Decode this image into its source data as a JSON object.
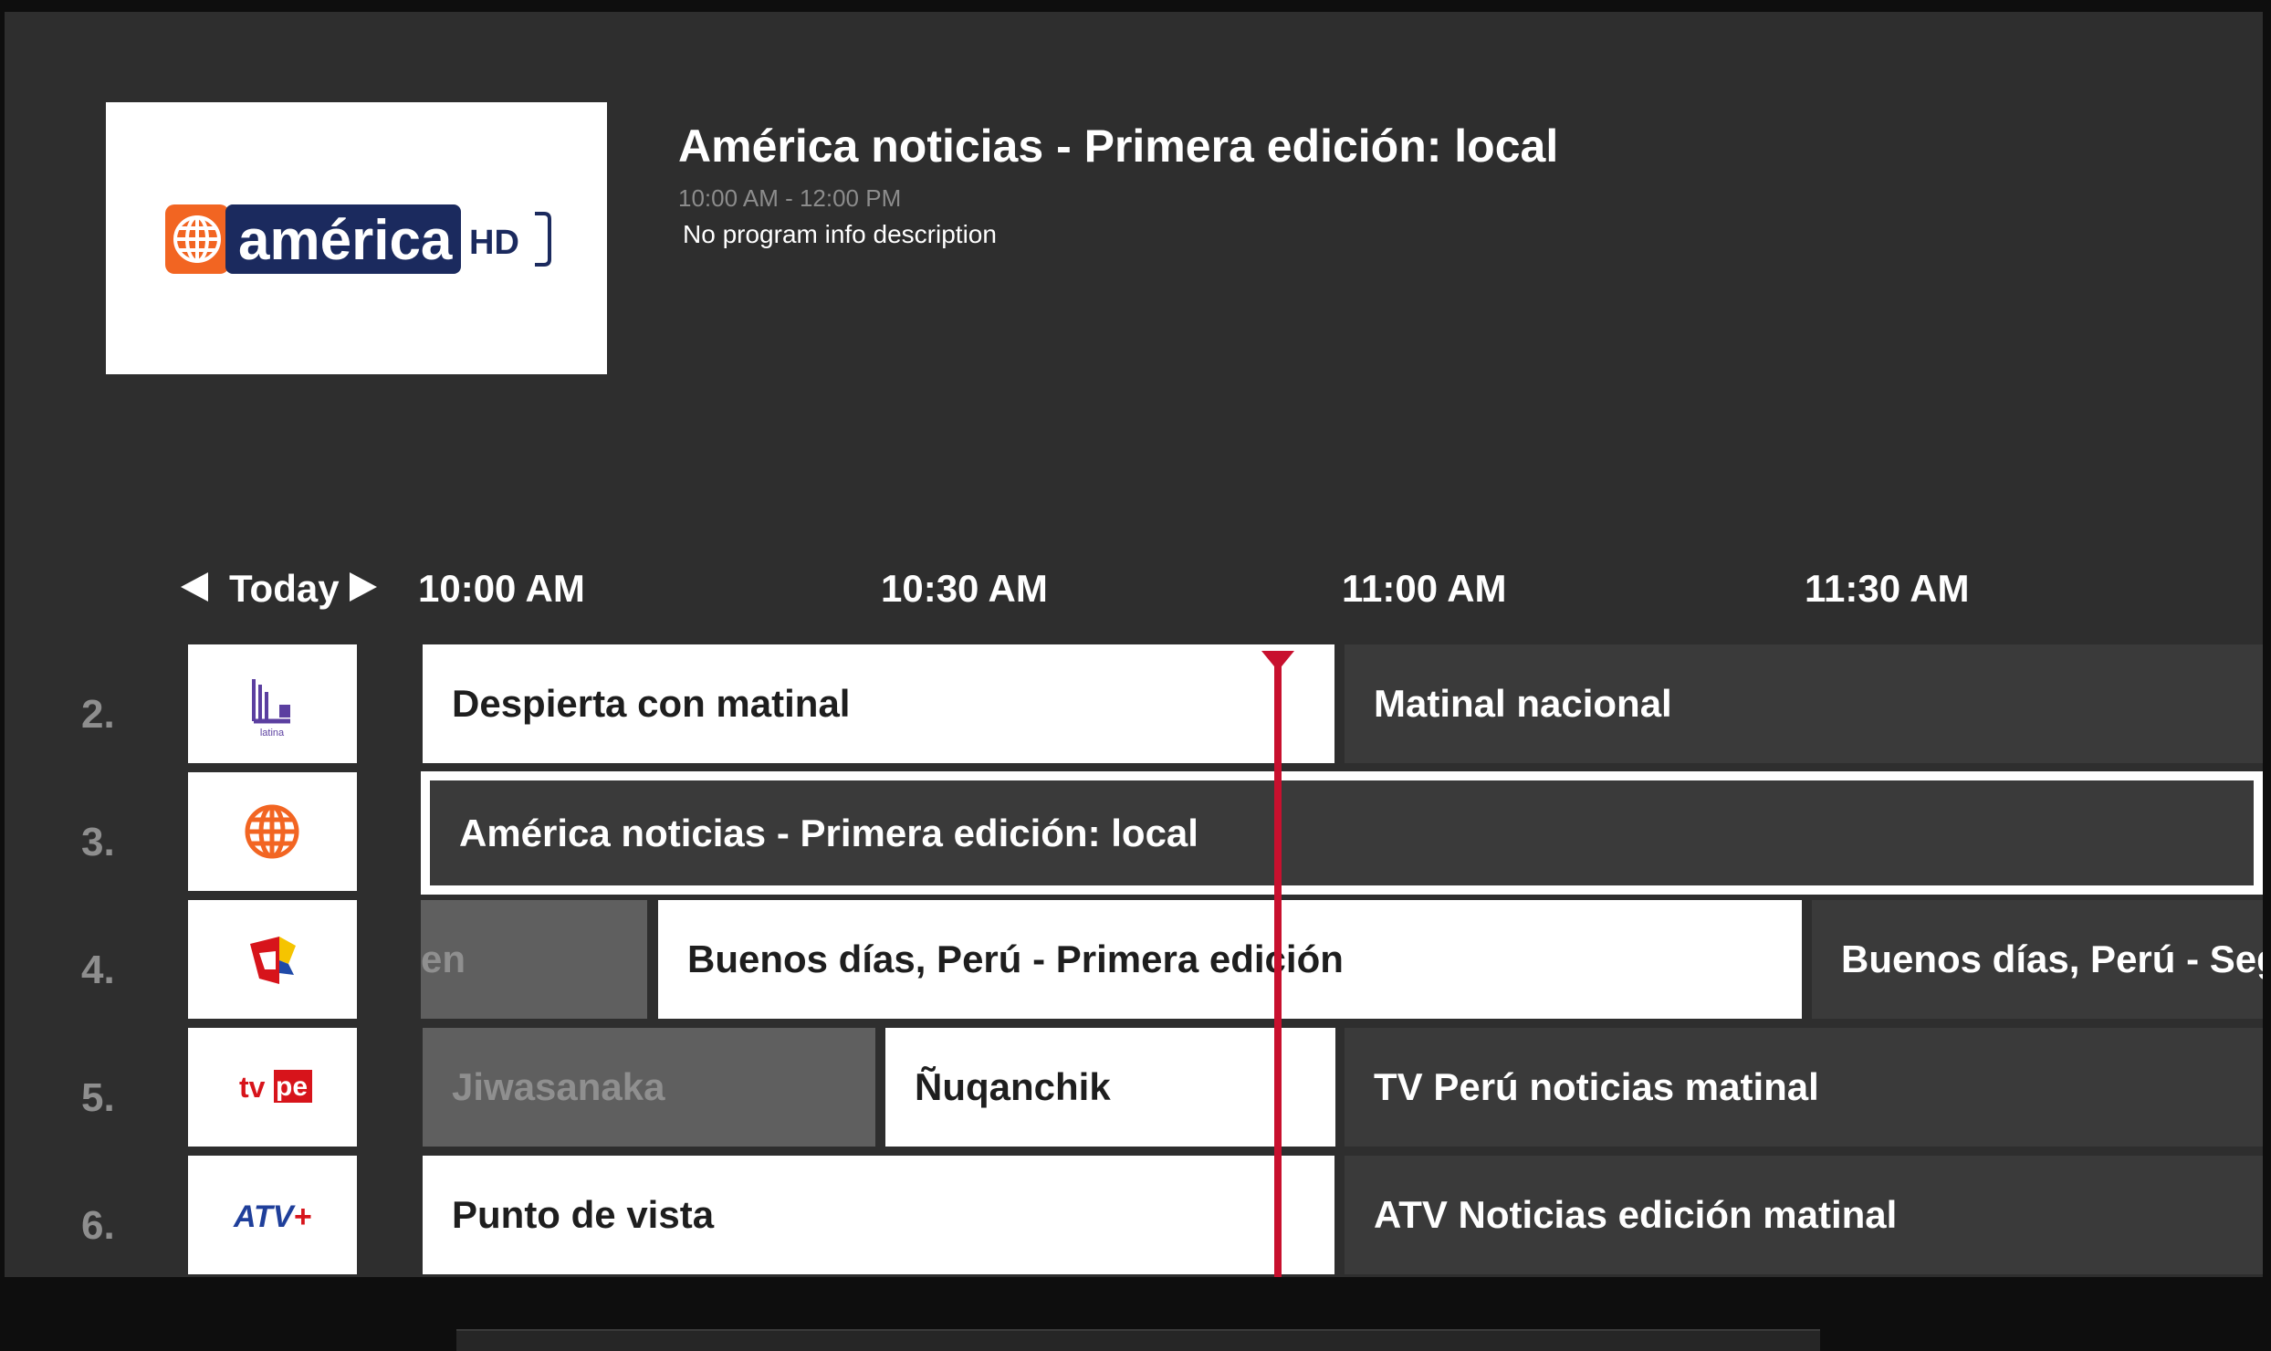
{
  "info": {
    "title": "América noticias - Primera edición: local",
    "time": "10:00 AM - 12:00 PM",
    "description": "No program info description",
    "logo_text": "américa",
    "logo_badge": "HD"
  },
  "guide": {
    "day": "Today",
    "times": [
      "10:00 AM",
      "10:30 AM",
      "11:00 AM",
      "11:30 AM"
    ]
  },
  "channels": [
    {
      "number": "2.",
      "logo": "latina-logo-icon",
      "logo_caption": "Latina",
      "programs": [
        "Despierta con matinal",
        "Matinal nacional"
      ]
    },
    {
      "number": "3.",
      "logo": "america-globe-icon",
      "programs": [
        "América noticias - Primera edición: local"
      ]
    },
    {
      "number": "4.",
      "logo": "panamericana-logo-icon",
      "programs": [
        "en",
        "Buenos días, Perú - Primera edición",
        "Buenos días, Perú - Segu"
      ]
    },
    {
      "number": "5.",
      "logo": "tvperu-logo-icon",
      "logo_caption": "tvpe",
      "programs": [
        "Jiwasanaka",
        "Ñuqanchik",
        "TV Perú noticias matinal"
      ]
    },
    {
      "number": "6.",
      "logo": "atv-plus-logo-icon",
      "logo_caption": "ATV+",
      "programs": [
        "Punto de vista",
        "ATV Noticias edición matinal"
      ]
    }
  ],
  "colors": {
    "accent": "#c8102e",
    "background": "#2e2e2e",
    "america_orange": "#f26522",
    "america_navy": "#1b2a5e"
  }
}
